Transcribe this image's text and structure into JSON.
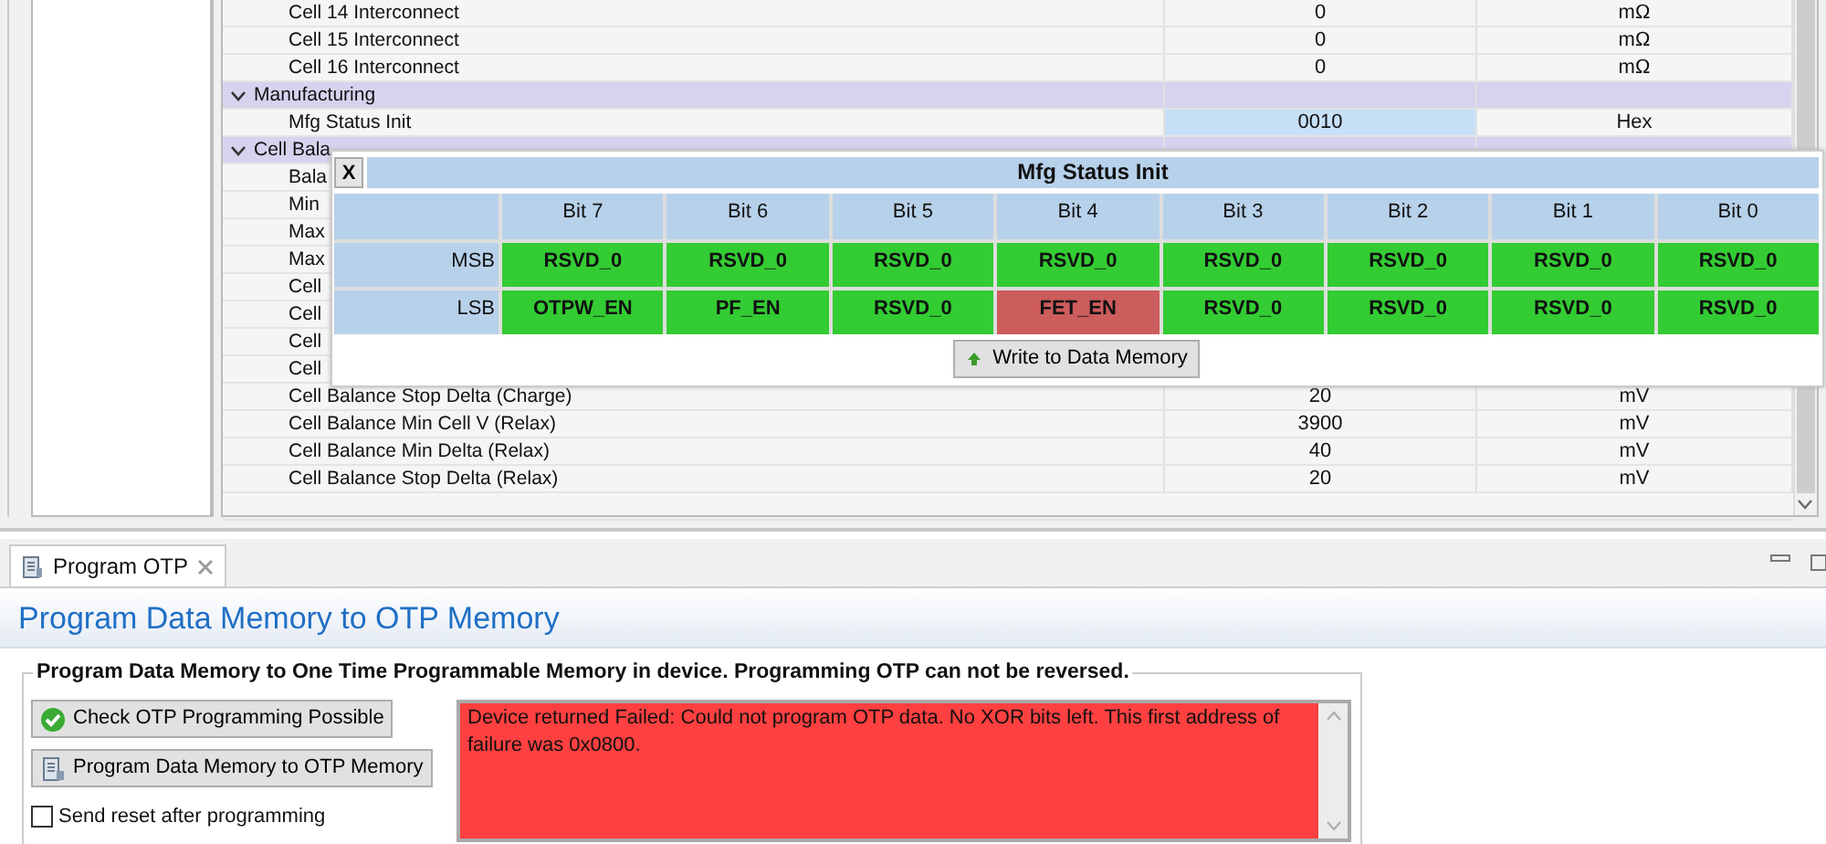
{
  "parameters": {
    "rows": [
      {
        "kind": "row",
        "name": "Cell 14 Interconnect",
        "value": "0",
        "unit": "mΩ",
        "selected": false
      },
      {
        "kind": "row",
        "name": "Cell 15 Interconnect",
        "value": "0",
        "unit": "mΩ",
        "selected": false
      },
      {
        "kind": "row",
        "name": "Cell 16 Interconnect",
        "value": "0",
        "unit": "mΩ",
        "selected": false
      },
      {
        "kind": "group",
        "name": "Manufacturing",
        "expanded": true
      },
      {
        "kind": "row",
        "name": "Mfg Status Init",
        "value": "0010",
        "unit": "Hex",
        "selected": true
      },
      {
        "kind": "group",
        "name": "Cell Bala",
        "expanded": true
      },
      {
        "kind": "row",
        "name": "Bala"
      },
      {
        "kind": "row",
        "name": "Min"
      },
      {
        "kind": "row",
        "name": "Max"
      },
      {
        "kind": "row",
        "name": "Max"
      },
      {
        "kind": "row",
        "name": "Cell"
      },
      {
        "kind": "row",
        "name": "Cell"
      },
      {
        "kind": "row",
        "name": "Cell"
      },
      {
        "kind": "row",
        "name": "Cell"
      },
      {
        "kind": "row",
        "name": "Cell Balance Stop Delta (Charge)",
        "value": "20",
        "unit": "mV",
        "selected": false
      },
      {
        "kind": "row",
        "name": "Cell Balance Min Cell V (Relax)",
        "value": "3900",
        "unit": "mV",
        "selected": false
      },
      {
        "kind": "row",
        "name": "Cell Balance Min Delta (Relax)",
        "value": "40",
        "unit": "mV",
        "selected": false
      },
      {
        "kind": "row",
        "name": "Cell Balance Stop Delta (Relax)",
        "value": "20",
        "unit": "mV",
        "selected": false
      }
    ]
  },
  "bit_editor": {
    "close_label": "X",
    "title": "Mfg Status Init",
    "columns": [
      "Bit 7",
      "Bit 6",
      "Bit 5",
      "Bit 4",
      "Bit 3",
      "Bit 2",
      "Bit 1",
      "Bit 0"
    ],
    "rows": [
      {
        "label": "MSB",
        "bits": [
          {
            "name": "RSVD_0",
            "set": false
          },
          {
            "name": "RSVD_0",
            "set": false
          },
          {
            "name": "RSVD_0",
            "set": false
          },
          {
            "name": "RSVD_0",
            "set": false
          },
          {
            "name": "RSVD_0",
            "set": false
          },
          {
            "name": "RSVD_0",
            "set": false
          },
          {
            "name": "RSVD_0",
            "set": false
          },
          {
            "name": "RSVD_0",
            "set": false
          }
        ]
      },
      {
        "label": "LSB",
        "bits": [
          {
            "name": "OTPW_EN",
            "set": false
          },
          {
            "name": "PF_EN",
            "set": false
          },
          {
            "name": "RSVD_0",
            "set": false
          },
          {
            "name": "FET_EN",
            "set": true
          },
          {
            "name": "RSVD_0",
            "set": false
          },
          {
            "name": "RSVD_0",
            "set": false
          },
          {
            "name": "RSVD_0",
            "set": false
          },
          {
            "name": "RSVD_0",
            "set": false
          }
        ]
      }
    ],
    "write_button": "Write to Data Memory"
  },
  "tabs": [
    {
      "label": "Program OTP",
      "selected": true
    }
  ],
  "otp": {
    "heading": "Program Data Memory to OTP Memory",
    "group_label": "Program Data Memory to One Time Programmable Memory in device.  Programming OTP can not be reversed.",
    "buttons": [
      {
        "label": "Check OTP Programming Possible",
        "kind": "check"
      },
      {
        "label": "Program Data Memory to OTP Memory",
        "kind": "program"
      }
    ],
    "reset_checkbox": {
      "label": "Send reset after programming",
      "checked": false
    },
    "message": {
      "text": "Device returned Failed:  Could not program OTP data. No XOR bits left.  This first address of failure was 0x0800.",
      "kind": "error"
    }
  }
}
